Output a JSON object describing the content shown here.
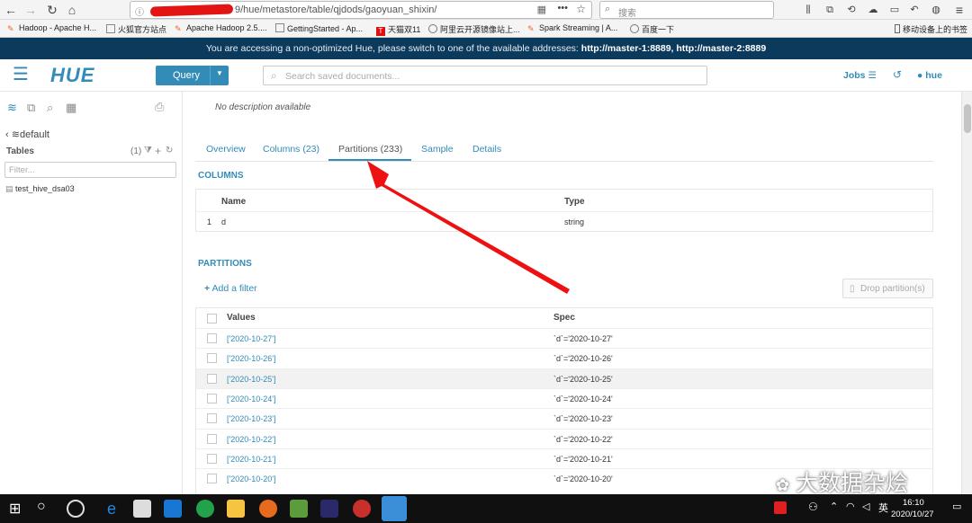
{
  "browser": {
    "url": "9/hue/metastore/table/qjdods/gaoyuan_shixin/",
    "search_placeholder": "搜索",
    "bookmarks": [
      "Hadoop - Apache H...",
      "火狐官方站点",
      "Apache Hadoop 2.5....",
      "GettingStarted - Ap...",
      "天猫双11",
      "阿里云开源镜像站上...",
      "百度一下",
      "Spark Streaming | A...",
      "移动设备上的书签"
    ]
  },
  "banner": {
    "text": "You are accessing a non-optimized Hue, please switch to one of the available addresses:",
    "addresses": "http://master-1:8889, http://master-2:8889"
  },
  "header": {
    "logo": "HUE",
    "query_label": "Query",
    "search_placeholder": "Search saved documents...",
    "jobs_label": "Jobs",
    "user_label": "hue"
  },
  "sidebar": {
    "database": "default",
    "tables_label": "Tables",
    "tables_count": "(1)",
    "filter_placeholder": "Filter...",
    "tables": [
      "test_hive_dsa03"
    ]
  },
  "main": {
    "description": "No description available",
    "tabs": [
      "Overview",
      "Columns (23)",
      "Partitions (233)",
      "Sample",
      "Details"
    ],
    "active_tab": "Partitions (233)",
    "columns_title": "COLUMNS",
    "columns_headers": [
      "Name",
      "Type"
    ],
    "columns_rows": [
      {
        "index": "1",
        "name": "d",
        "type": "string"
      }
    ],
    "partitions_title": "PARTITIONS",
    "add_filter_label": "Add a filter",
    "drop_partition_label": "Drop partition(s)",
    "partitions_headers": [
      "Values",
      "Spec"
    ],
    "partitions_rows": [
      {
        "value": "['2020-10-27']",
        "spec": "`d`='2020-10-27'"
      },
      {
        "value": "['2020-10-26']",
        "spec": "`d`='2020-10-26'"
      },
      {
        "value": "['2020-10-25']",
        "spec": "`d`='2020-10-25'"
      },
      {
        "value": "['2020-10-24']",
        "spec": "`d`='2020-10-24'"
      },
      {
        "value": "['2020-10-23']",
        "spec": "`d`='2020-10-23'"
      },
      {
        "value": "['2020-10-22']",
        "spec": "`d`='2020-10-22'"
      },
      {
        "value": "['2020-10-21']",
        "spec": "`d`='2020-10-21'"
      },
      {
        "value": "['2020-10-20']",
        "spec": "`d`='2020-10-20'"
      }
    ]
  },
  "taskbar": {
    "time": "16:10",
    "date": "2020/10/27"
  },
  "watermark": "大数据杂烩",
  "colors": {
    "accent": "#338bb8",
    "banner": "#0c3a5d",
    "arrow": "#ee1111"
  }
}
